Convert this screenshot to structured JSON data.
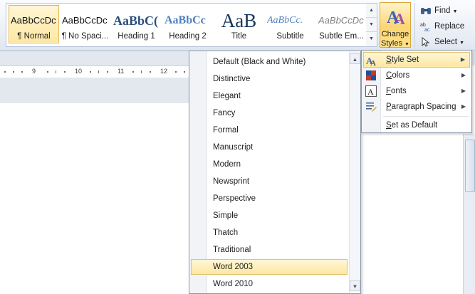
{
  "ribbon": {
    "styles_gallery": [
      {
        "preview": "AaBbCcDc",
        "name": "¶ Normal",
        "selected": true
      },
      {
        "preview": "AaBbCcDc",
        "name": "¶ No Spaci..."
      },
      {
        "preview": "AaBbC(",
        "name": "Heading 1"
      },
      {
        "preview": "AaBbCc",
        "name": "Heading 2"
      },
      {
        "preview": "AaB",
        "name": "Title"
      },
      {
        "preview": "AaBbCc.",
        "name": "Subtitle"
      },
      {
        "preview": "AaBbCcDc",
        "name": "Subtle Em..."
      }
    ],
    "change_styles": {
      "line1": "Change",
      "line2": "Styles",
      "icon": "change-styles-icon"
    },
    "editing": {
      "find": "Find",
      "replace": "Replace",
      "select": "Select"
    }
  },
  "ruler": {
    "numbers": [
      "9",
      "10",
      "11",
      "12"
    ]
  },
  "style_set_menu": {
    "items": [
      "Default (Black and White)",
      "Distinctive",
      "Elegant",
      "Fancy",
      "Formal",
      "Manuscript",
      "Modern",
      "Newsprint",
      "Perspective",
      "Simple",
      "Thatch",
      "Traditional",
      "Word 2003",
      "Word 2010"
    ],
    "highlighted": "Word 2003"
  },
  "change_styles_menu": {
    "items": [
      {
        "label": "Style Set",
        "accel": "Y",
        "has_submenu": true,
        "icon": "style-set-icon"
      },
      {
        "label": "Colors",
        "accel": "C",
        "has_submenu": true,
        "icon": "colors-icon"
      },
      {
        "label": "Fonts",
        "accel": "F",
        "has_submenu": true,
        "icon": "fonts-icon"
      },
      {
        "label": "Paragraph Spacing",
        "accel": "P",
        "has_submenu": true,
        "icon": "paragraph-spacing-icon"
      },
      {
        "label": "Set as Default",
        "accel": "S",
        "has_submenu": false
      }
    ]
  },
  "colors": {
    "accent_highlight": "#fde7a2",
    "menu_border": "#8a97a8",
    "ribbon_bg": "#e6ecf4"
  }
}
